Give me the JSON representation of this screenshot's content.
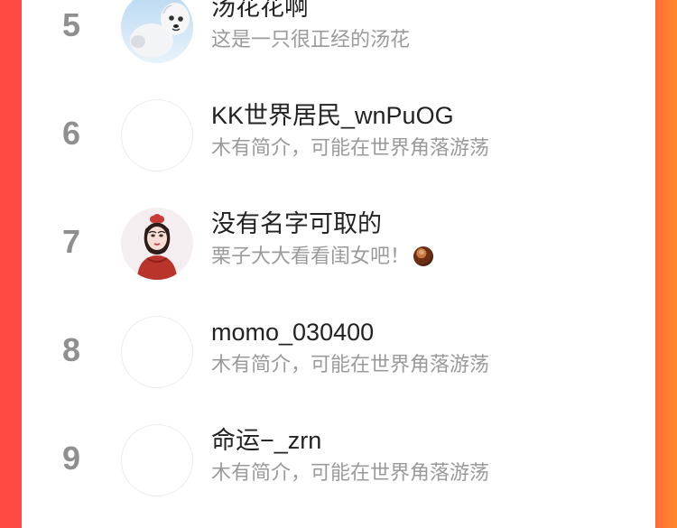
{
  "ranking": {
    "rows": [
      {
        "rank": "5",
        "name": "汤花花啊",
        "bio": "这是一只很正经的汤花",
        "avatar_icon": "seal-avatar"
      },
      {
        "rank": "6",
        "name": "KK世界居民_wnPuOG",
        "bio": "木有简介，可能在世界角落游荡",
        "avatar_icon": "blank-avatar"
      },
      {
        "rank": "7",
        "name": "没有名字可取的",
        "bio": "栗子大大看看闺女吧！",
        "bio_emoji": "chestnut-icon",
        "avatar_icon": "woman-portrait-avatar"
      },
      {
        "rank": "8",
        "name": "momo_030400",
        "bio": "木有简介，可能在世界角落游荡",
        "avatar_icon": "blank-avatar"
      },
      {
        "rank": "9",
        "name": "命运−_zrn",
        "bio": "木有简介，可能在世界角落游荡",
        "avatar_icon": "blank-avatar"
      }
    ]
  },
  "colors": {
    "left_edge": "#ff4a43",
    "right_edge": "#ff7a32",
    "panel_bg": "#ffffff",
    "rank": "#8f8f8f",
    "name": "#222222",
    "bio": "#9a9a9a"
  }
}
